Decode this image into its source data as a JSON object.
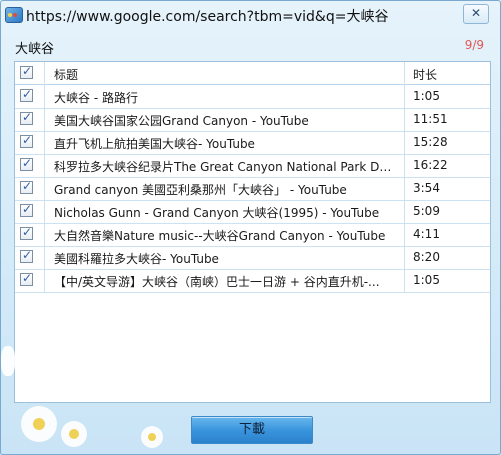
{
  "window": {
    "title": "https://www.google.com/search?tbm=vid&q=大峡谷",
    "close_label": "✕"
  },
  "search": {
    "keyword": "大峡谷",
    "count": "9/9"
  },
  "table": {
    "headers": {
      "title": "标题",
      "duration": "时长"
    },
    "rows": [
      {
        "title": "大峡谷 - 路路行",
        "duration": "1:05",
        "checked": true
      },
      {
        "title": "美国大峡谷国家公园Grand Canyon - YouTube",
        "duration": "11:51",
        "checked": true
      },
      {
        "title": "直升飞机上航拍美国大峡谷- YouTube",
        "duration": "15:28",
        "checked": true
      },
      {
        "title": "科罗拉多大峡谷纪录片The Great Canyon National Park Do...",
        "duration": "16:22",
        "checked": true
      },
      {
        "title": "Grand canyon 美國亞利桑那州「大峽谷」 - YouTube",
        "duration": "3:54",
        "checked": true
      },
      {
        "title": "Nicholas Gunn - Grand Canyon 大峡谷(1995) - YouTube",
        "duration": "5:09",
        "checked": true
      },
      {
        "title": "大自然音樂Nature music--大峽谷Grand Canyon - YouTube",
        "duration": "4:11",
        "checked": true
      },
      {
        "title": "美國科羅拉多大峽谷- YouTube",
        "duration": "8:20",
        "checked": true
      },
      {
        "title": "【中/英文导游】大峡谷（南峡）巴士一日游 + 谷内直升机-...",
        "duration": "1:05",
        "checked": true
      }
    ]
  },
  "footer": {
    "download_label": "下載"
  },
  "icons": {
    "app": "app-icon",
    "check": "check-icon",
    "close": "close-icon"
  },
  "colors": {
    "count": "#e25656",
    "button": "#3a95dd"
  }
}
